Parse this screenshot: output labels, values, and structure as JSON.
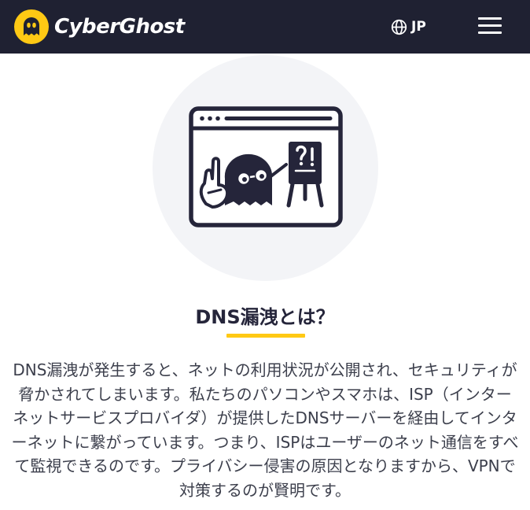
{
  "header": {
    "brand_name": "CyberGhost",
    "language_label": "JP",
    "colors": {
      "background": "#1f2132",
      "accent": "#ffc914"
    },
    "icons": {
      "logo": "cyberghost-logo-icon",
      "language": "globe-icon",
      "menu": "hamburger-menu-icon"
    }
  },
  "hero": {
    "illustration": "dns-leak-browser-ghost-icon"
  },
  "content": {
    "heading": "DNS漏洩とは？",
    "paragraph": "DNS漏洩が発生すると、ネットの利用状況が公開され、セキュリティが脅かされてしまいます。私たちのパソコンやスマホは、ISP（インターネットサービスプロバイダ）が提供したDNSサーバーを経由してインターネットに繋がっています。つまり、ISPはユーザーのネット通信をすべて監視できるのです。プライバシー侵害の原因となりますから、VPNで対策するのが賢明です。"
  }
}
